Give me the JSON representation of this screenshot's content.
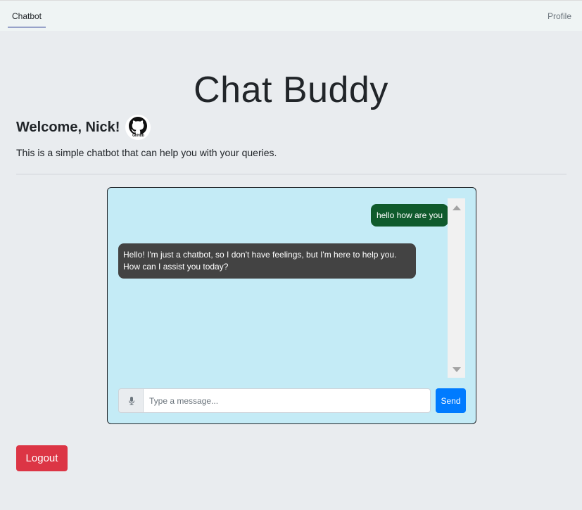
{
  "nav": {
    "tabs": [
      {
        "label": "Chatbot",
        "active": true
      },
      {
        "label": "Profile",
        "active": false
      }
    ]
  },
  "header": {
    "title": "Chat Buddy",
    "welcome": "Welcome, Nick!",
    "github_label": "GitHub",
    "subtitle": "This is a simple chatbot that can help you with your queries."
  },
  "chat": {
    "messages": [
      {
        "role": "user",
        "text": "hello how are you"
      },
      {
        "role": "bot",
        "text": "Hello! I'm just a chatbot, so I don't have feelings, but I'm here to help you. How can I assist you today?"
      }
    ],
    "input": {
      "value": "",
      "placeholder": "Type a message..."
    },
    "send_label": "Send",
    "mic_icon": "microphone-icon"
  },
  "logout_label": "Logout",
  "colors": {
    "background": "#e9ecef",
    "chat_background": "#c4ebf6",
    "user_bubble": "#0f5a2c",
    "bot_bubble": "#434343",
    "send": "#007bff",
    "logout": "#dc3545",
    "active_tab_underline": "#1a2b8a"
  }
}
